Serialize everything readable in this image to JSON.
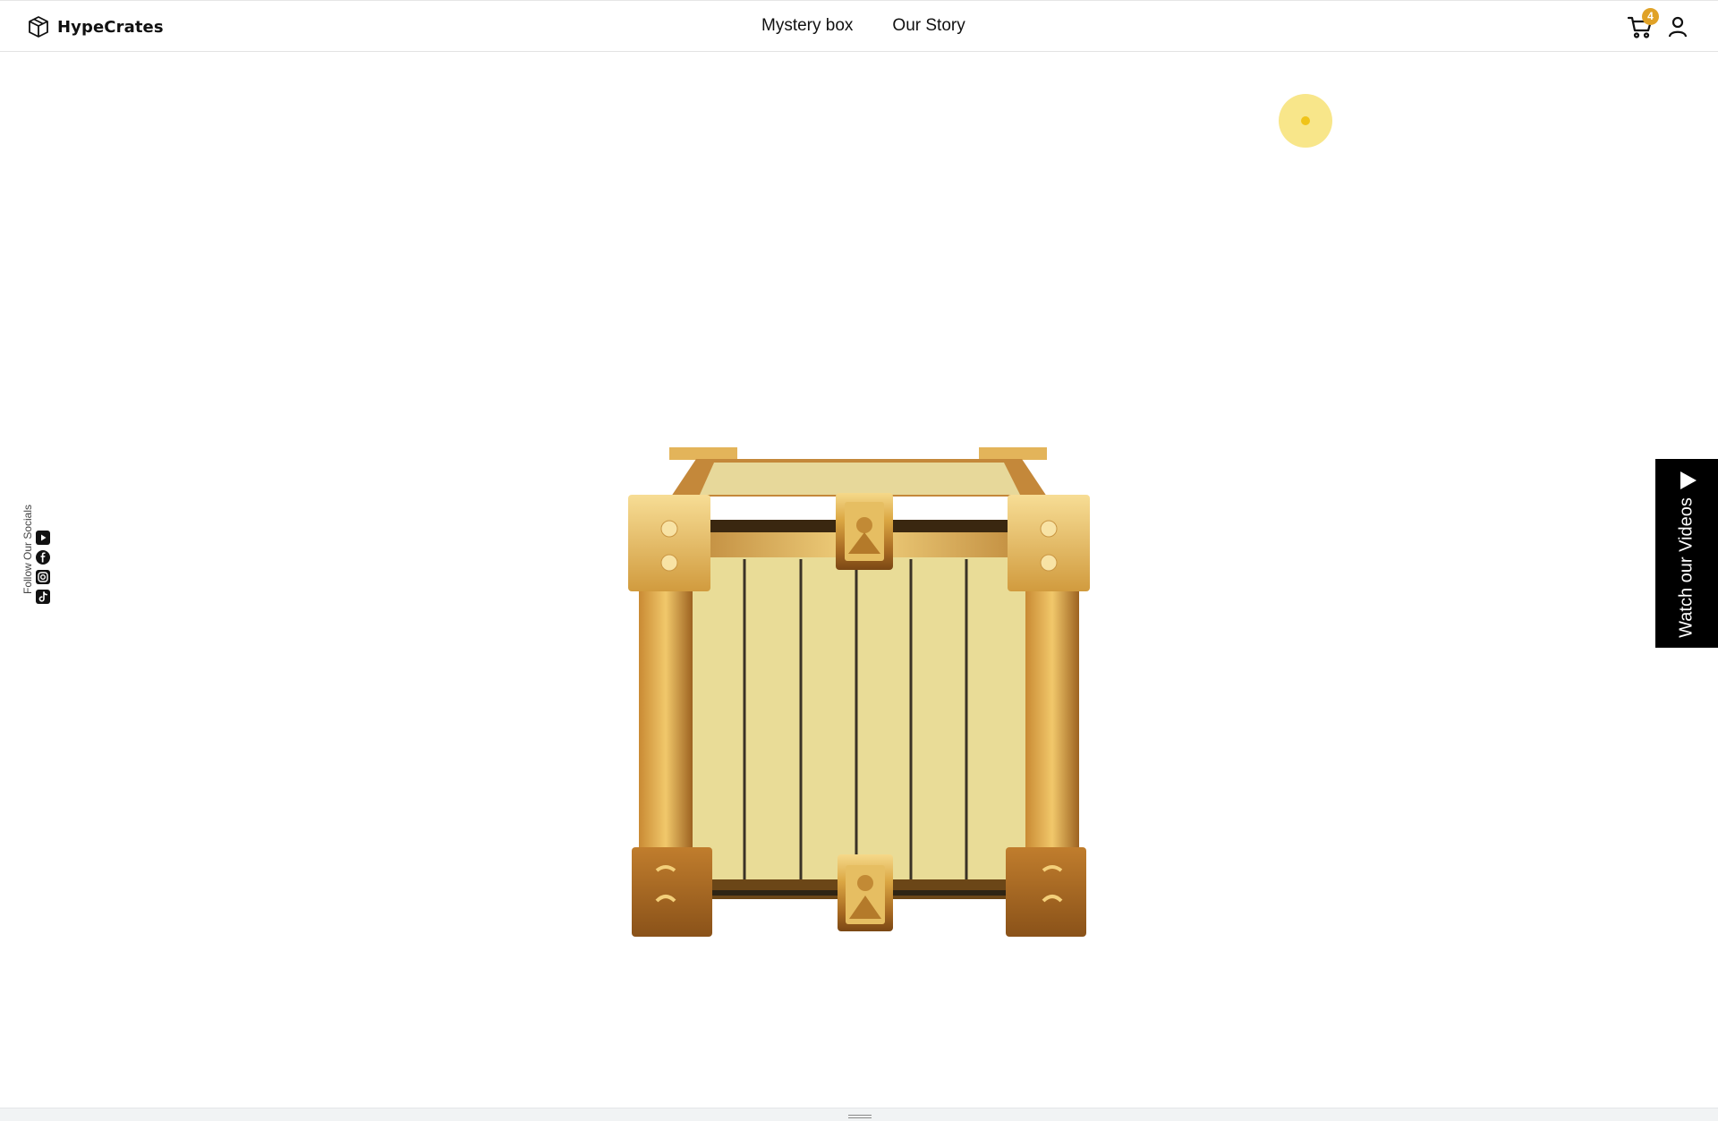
{
  "header": {
    "brand": "HypeCrates",
    "nav": [
      {
        "label": "Mystery box"
      },
      {
        "label": "Our Story"
      }
    ],
    "cart_count": "4",
    "cart_icon": "cart-icon",
    "user_icon": "user-icon"
  },
  "socials": {
    "label": "Follow Our Socials",
    "icons": [
      "youtube-icon",
      "facebook-icon",
      "instagram-icon",
      "tiktok-icon"
    ]
  },
  "watch_panel": {
    "label": "Watch our Videos",
    "icon": "play-icon"
  },
  "colors": {
    "accent": "#e0a227",
    "cursor": "#f8e68a",
    "gold": "#d9a23a",
    "wood": "#e9dc97"
  }
}
